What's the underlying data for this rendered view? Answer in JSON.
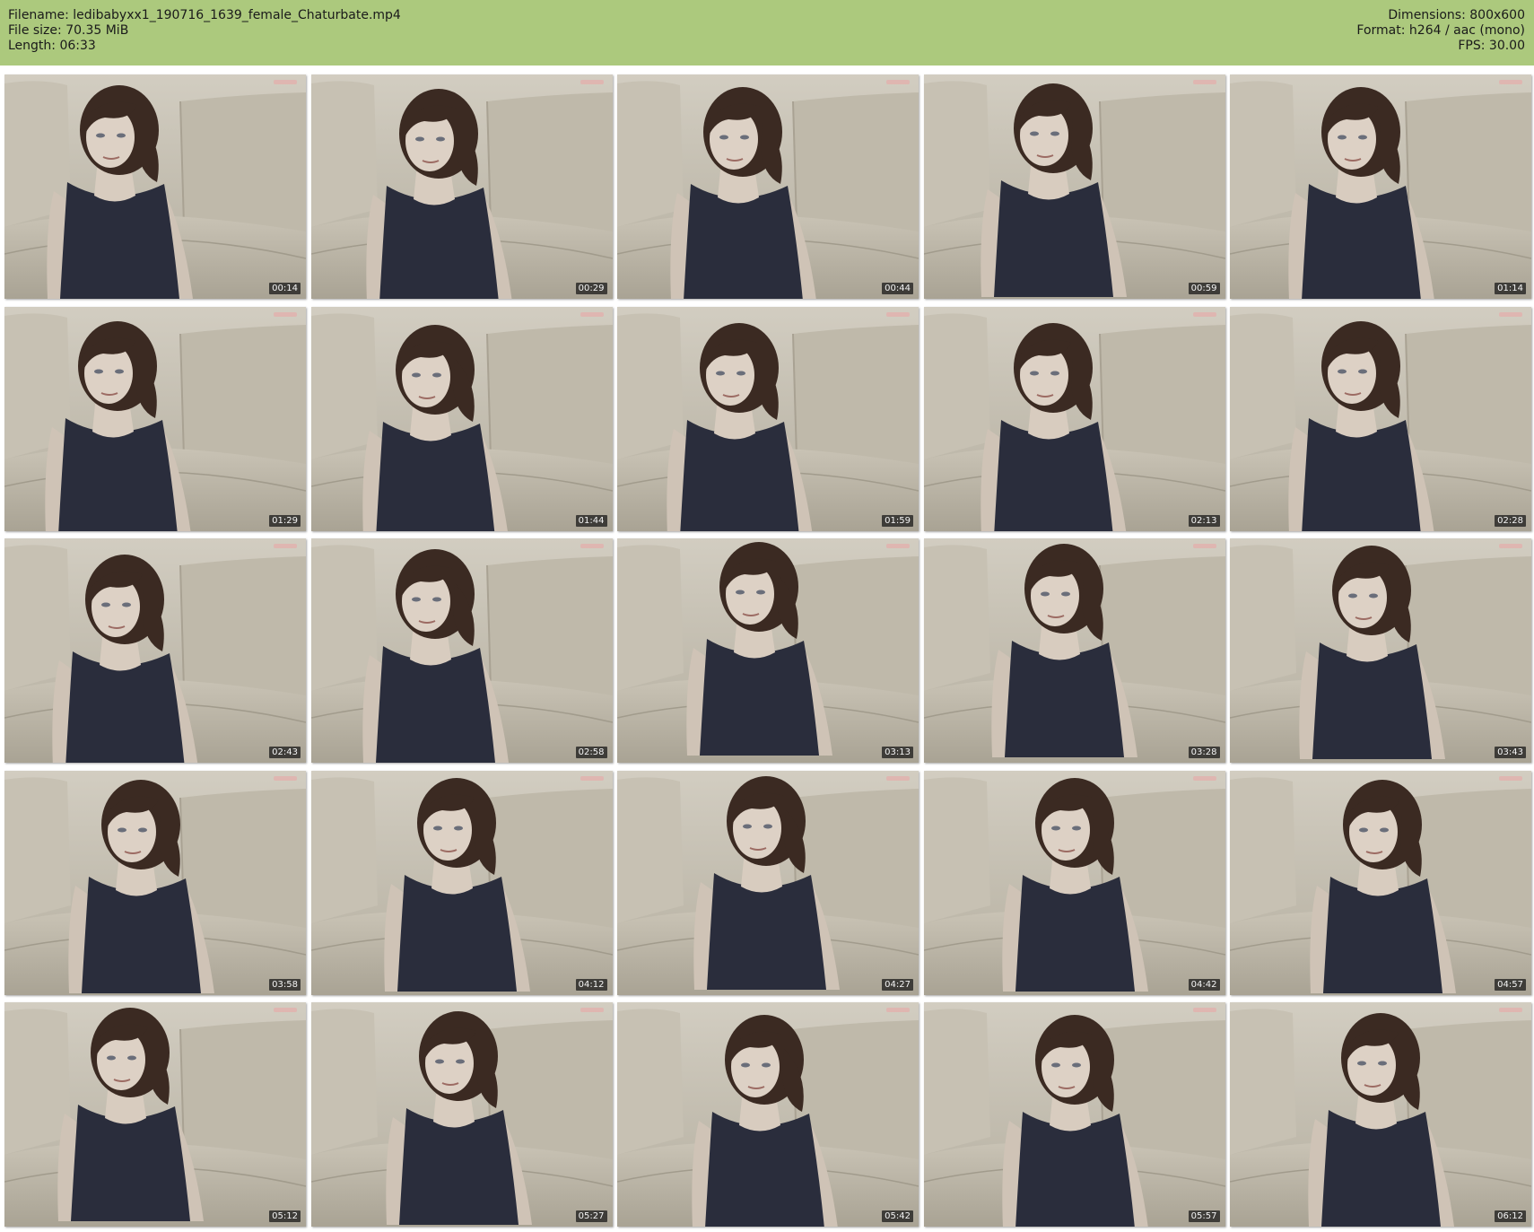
{
  "header": {
    "filename_label": "Filename: ledibabyxx1_190716_1639_female_Chaturbate.mp4",
    "filesize_label": "File size: 70.35 MiB",
    "length_label": "Length: 06:33",
    "dimensions_label": "Dimensions: 800x600",
    "format_label": "Format: h264 / aac (mono)",
    "fps_label": "FPS: 30.00",
    "background_color": "#acc97d"
  },
  "thumbnails": [
    {
      "time": "00:14"
    },
    {
      "time": "00:29"
    },
    {
      "time": "00:44"
    },
    {
      "time": "00:59"
    },
    {
      "time": "01:14"
    },
    {
      "time": "01:29"
    },
    {
      "time": "01:44"
    },
    {
      "time": "01:59"
    },
    {
      "time": "02:13"
    },
    {
      "time": "02:28"
    },
    {
      "time": "02:43"
    },
    {
      "time": "02:58"
    },
    {
      "time": "03:13"
    },
    {
      "time": "03:28"
    },
    {
      "time": "03:43"
    },
    {
      "time": "03:58"
    },
    {
      "time": "04:12"
    },
    {
      "time": "04:27"
    },
    {
      "time": "04:42"
    },
    {
      "time": "04:57"
    },
    {
      "time": "05:12"
    },
    {
      "time": "05:27"
    },
    {
      "time": "05:42"
    },
    {
      "time": "05:57"
    },
    {
      "time": "06:12"
    }
  ]
}
